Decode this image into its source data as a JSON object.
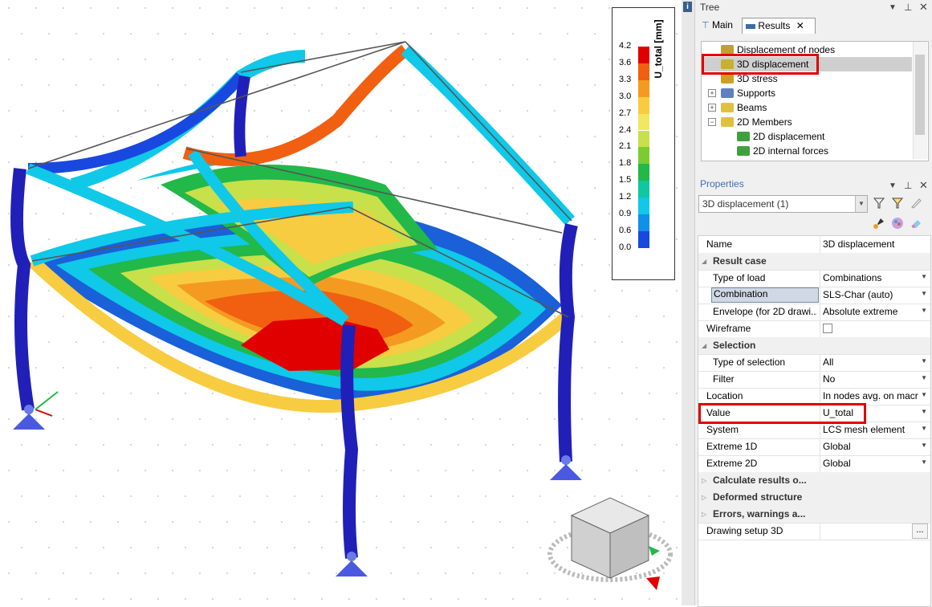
{
  "legend": {
    "title": "U_total [mm]",
    "labels": [
      "4.2",
      "3.6",
      "3.3",
      "3.0",
      "2.7",
      "2.4",
      "2.1",
      "1.8",
      "1.5",
      "1.2",
      "0.9",
      "0.6",
      "0.0"
    ],
    "colors": [
      "#e00000",
      "#f06010",
      "#f59a20",
      "#f8cc40",
      "#f0e860",
      "#c8e04a",
      "#7ccc30",
      "#22b84a",
      "#10c8a0",
      "#10c8e8",
      "#1090e8",
      "#1848e0",
      "#2020b8"
    ]
  },
  "tree": {
    "title": "Tree",
    "tabs": {
      "main": "Main",
      "results": "Results"
    },
    "items": [
      {
        "label": "Displacement of nodes",
        "indent": 0
      },
      {
        "label": "3D displacement",
        "indent": 0,
        "selected": true
      },
      {
        "label": "3D stress",
        "indent": 0
      },
      {
        "label": "Supports",
        "indent": 0,
        "expander": "+"
      },
      {
        "label": "Beams",
        "indent": 0,
        "expander": "+"
      },
      {
        "label": "2D Members",
        "indent": 0,
        "expander": "−"
      },
      {
        "label": "2D displacement",
        "indent": 1
      },
      {
        "label": "2D internal forces",
        "indent": 1
      }
    ]
  },
  "properties": {
    "title": "Properties",
    "selector": "3D displacement (1)",
    "rows": [
      {
        "name": "Name",
        "value": "3D displacement"
      },
      {
        "name": "Result case",
        "section": true
      },
      {
        "name": "Type of load",
        "value": "Combinations",
        "dropdown": true
      },
      {
        "name": "Combination",
        "value": "SLS-Char (auto)",
        "dropdown": true
      },
      {
        "name": "Envelope (for 2D drawi...",
        "value": "Absolute extreme",
        "dropdown": true
      },
      {
        "name": "Wireframe",
        "value": "",
        "checkbox": true
      },
      {
        "name": "Selection",
        "section": true
      },
      {
        "name": "Type of selection",
        "value": "All",
        "dropdown": true
      },
      {
        "name": "Filter",
        "value": "No",
        "dropdown": true
      },
      {
        "name": "Location",
        "value": "In nodes avg. on macr",
        "dropdown": true
      },
      {
        "name": "Value",
        "value": "U_total",
        "dropdown": true
      },
      {
        "name": "System",
        "value": "LCS mesh element",
        "dropdown": true
      },
      {
        "name": "Extreme 1D",
        "value": "Global",
        "dropdown": true
      },
      {
        "name": "Extreme 2D",
        "value": "Global",
        "dropdown": true
      },
      {
        "name": "Calculate results o...",
        "section": true,
        "collapsed": true
      },
      {
        "name": "Deformed structure",
        "section": true,
        "collapsed": true
      },
      {
        "name": "Errors, warnings a...",
        "section": true,
        "collapsed": true
      },
      {
        "name": "Drawing setup 3D",
        "value": "",
        "ellipsis": "..."
      }
    ]
  }
}
